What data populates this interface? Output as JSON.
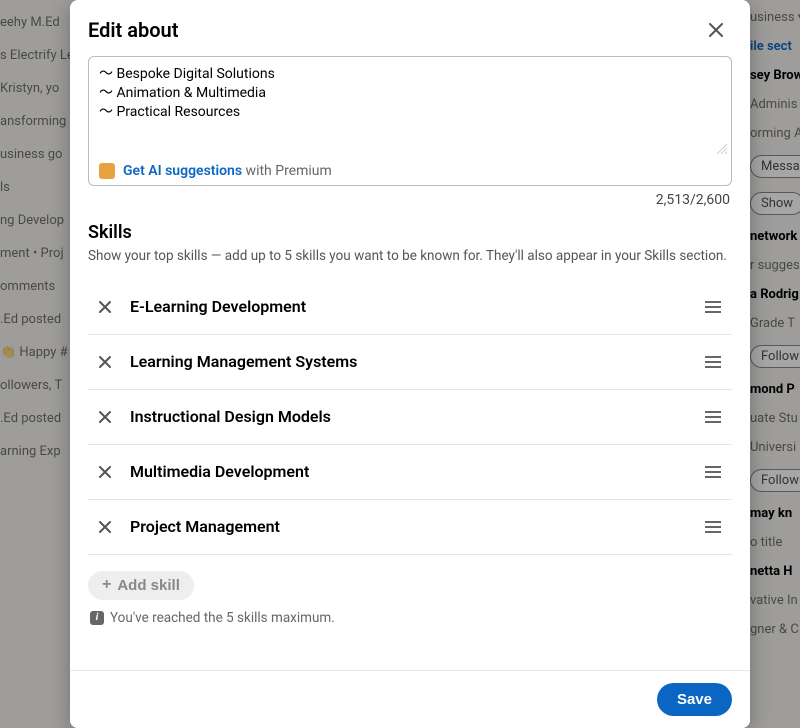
{
  "modal": {
    "title": "Edit about",
    "textarea_value": "～ Bespoke Digital Solutions\n～ Animation & Multimedia\n～ Practical Resources",
    "ai_link": "Get AI suggestions",
    "ai_suffix": "with Premium",
    "char_count": "2,513/2,600",
    "skills_title": "Skills",
    "skills_sub": "Show your top skills — add up to 5 skills you want to be known for. They'll also appear in your Skills section.",
    "skills": [
      {
        "name": "E-Learning Development"
      },
      {
        "name": "Learning Management Systems"
      },
      {
        "name": "Instructional Design Models"
      },
      {
        "name": "Multimedia Development"
      },
      {
        "name": "Project Management"
      }
    ],
    "add_skill_label": "Add skill",
    "max_note": "You've reached the 5 skills maximum.",
    "save_label": "Save"
  },
  "background": {
    "left": [
      "eehy M.Ed",
      "s Electrify Le",
      "Kristyn, yo",
      "ansforming",
      "usiness go",
      "ls",
      "ng Develop",
      "ment • Proj",
      "omments",
      ".Ed posted",
      "👏 Happy #",
      "ollowers, T",
      ".Ed posted",
      "arning Exp"
    ],
    "right": [
      {
        "text": "usiness ▾",
        "type": "text"
      },
      {
        "text": "ile sect",
        "type": "link"
      },
      {
        "text": "sey Brow",
        "type": "bold"
      },
      {
        "text": "Adminis",
        "type": "text"
      },
      {
        "text": "orming A",
        "type": "text"
      },
      {
        "text": "Messa",
        "type": "btn"
      },
      {
        "text": "Show",
        "type": "btn"
      },
      {
        "text": "network",
        "type": "bold"
      },
      {
        "text": "r sugges",
        "type": "text"
      },
      {
        "text": "a Rodrig",
        "type": "bold"
      },
      {
        "text": "Grade T",
        "type": "text"
      },
      {
        "text": "Follow",
        "type": "btn"
      },
      {
        "text": "mond P",
        "type": "bold"
      },
      {
        "text": "uate Stu",
        "type": "text"
      },
      {
        "text": "Universi",
        "type": "text"
      },
      {
        "text": "Follow",
        "type": "btn"
      },
      {
        "text": "may kn",
        "type": "bold"
      },
      {
        "text": "o title",
        "type": "text"
      },
      {
        "text": "netta H",
        "type": "bold"
      },
      {
        "text": "vative In",
        "type": "text"
      },
      {
        "text": "gner & C",
        "type": "text"
      }
    ]
  }
}
